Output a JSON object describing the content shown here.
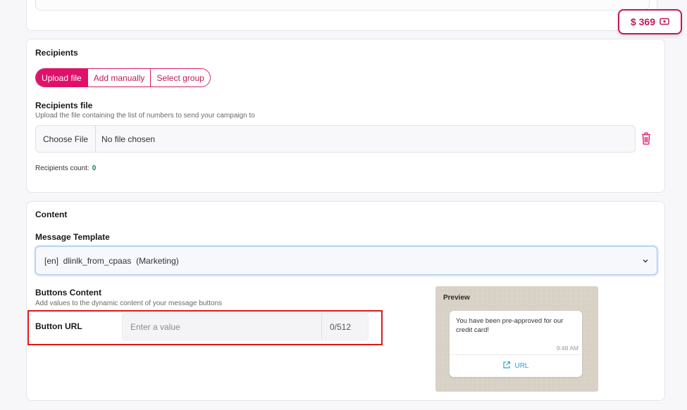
{
  "balance": {
    "amount": "$ 369",
    "icon": "cash-icon"
  },
  "recipients": {
    "title": "Recipients",
    "tabs": [
      {
        "label": "Upload file",
        "active": true
      },
      {
        "label": "Add manually",
        "active": false
      },
      {
        "label": "Select group",
        "active": false
      }
    ],
    "file_label": "Recipients file",
    "file_helper": "Upload the file containing the list of numbers to send your campaign to",
    "choose_file": "Choose File",
    "no_file": "No file chosen",
    "count_label": "Recipients count:",
    "count_value": "0"
  },
  "content": {
    "title": "Content",
    "template_label": "Message Template",
    "template_value": "[en]  dlinlk_from_cpaas  (Marketing)",
    "buttons_title": "Buttons Content",
    "buttons_helper": "Add values to the dynamic content of your message buttons",
    "button_url_label": "Button URL",
    "button_url_placeholder": "Enter a value",
    "button_url_counter": "0/512"
  },
  "preview": {
    "title": "Preview",
    "message": "You have been pre-approved for our credit card!",
    "time": "9:48 AM",
    "link_label": "URL"
  },
  "colors": {
    "accent": "#e0106b",
    "highlight": "#e01818",
    "link": "#2aa3d8",
    "count": "#0f7b6c"
  }
}
